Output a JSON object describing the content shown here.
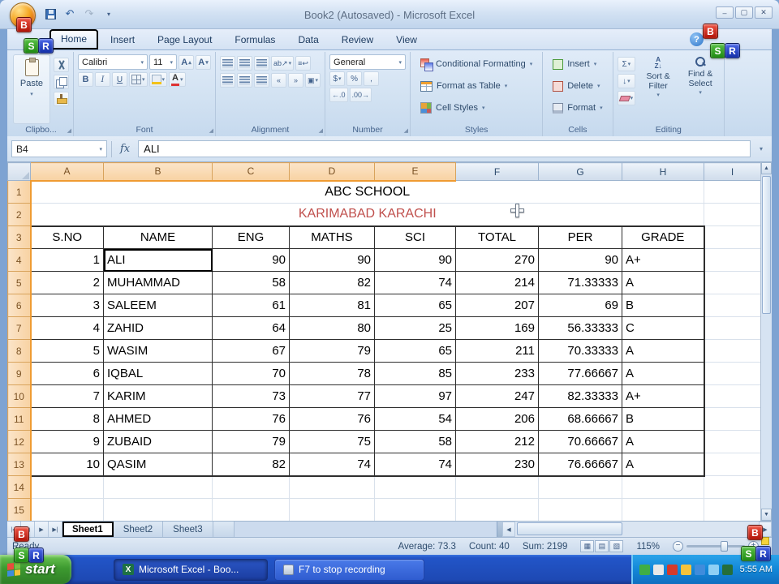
{
  "window": {
    "title": "Book2 (Autosaved) - Microsoft Excel"
  },
  "titlebar_controls": {
    "minimize": "–",
    "maximize": "▢",
    "close": "✕"
  },
  "ribbon": {
    "tabs": [
      {
        "label": "Home",
        "active": true
      },
      {
        "label": "Insert"
      },
      {
        "label": "Page Layout"
      },
      {
        "label": "Formulas"
      },
      {
        "label": "Data"
      },
      {
        "label": "Review"
      },
      {
        "label": "View"
      }
    ],
    "help": "?",
    "clipboard": {
      "label": "Clipbo...",
      "paste": "Paste"
    },
    "font": {
      "label": "Font",
      "family": "Calibri",
      "size": "11",
      "bold": "B",
      "italic": "I",
      "underline": "U"
    },
    "alignment": {
      "label": "Alignment"
    },
    "number": {
      "label": "Number",
      "format": "General",
      "currency": "$",
      "percent": "%",
      "comma": ","
    },
    "styles": {
      "label": "Styles",
      "items": [
        "Conditional Formatting",
        "Format as Table",
        "Cell Styles"
      ]
    },
    "cells": {
      "label": "Cells",
      "items": [
        "Insert",
        "Delete",
        "Format"
      ]
    },
    "editing": {
      "label": "Editing",
      "autosum": "Σ",
      "sort_filter": "Sort & Filter",
      "find_select": "Find & Select"
    }
  },
  "formula_bar": {
    "name_box": "B4",
    "fx": "fx",
    "content": "ALI"
  },
  "sheet": {
    "columns": [
      "A",
      "B",
      "C",
      "D",
      "E",
      "F",
      "G",
      "H",
      "I"
    ],
    "selected_columns": [
      "A",
      "B",
      "C",
      "D",
      "E"
    ],
    "active_cell": "B4",
    "title_row_1": "ABC SCHOOL",
    "title_row_2": "KARIMABAD KARACHI",
    "title_row_2_color": "#C0504D",
    "header_row": [
      "S.NO",
      "NAME",
      "ENG",
      "MATHS",
      "SCI",
      "TOTAL",
      "PER",
      "GRADE"
    ],
    "data_rows": [
      {
        "sno": "1",
        "name": "ALI",
        "eng": "90",
        "maths": "90",
        "sci": "90",
        "total": "270",
        "per": "90",
        "grade": "A+"
      },
      {
        "sno": "2",
        "name": "MUHAMMAD",
        "eng": "58",
        "maths": "82",
        "sci": "74",
        "total": "214",
        "per": "71.33333",
        "grade": "A"
      },
      {
        "sno": "3",
        "name": "SALEEM",
        "eng": "61",
        "maths": "81",
        "sci": "65",
        "total": "207",
        "per": "69",
        "grade": "B"
      },
      {
        "sno": "4",
        "name": "ZAHID",
        "eng": "64",
        "maths": "80",
        "sci": "25",
        "total": "169",
        "per": "56.33333",
        "grade": "C"
      },
      {
        "sno": "5",
        "name": "WASIM",
        "eng": "67",
        "maths": "79",
        "sci": "65",
        "total": "211",
        "per": "70.33333",
        "grade": "A"
      },
      {
        "sno": "6",
        "name": "IQBAL",
        "eng": "70",
        "maths": "78",
        "sci": "85",
        "total": "233",
        "per": "77.66667",
        "grade": "A"
      },
      {
        "sno": "7",
        "name": "KARIM",
        "eng": "73",
        "maths": "77",
        "sci": "97",
        "total": "247",
        "per": "82.33333",
        "grade": "A+"
      },
      {
        "sno": "8",
        "name": "AHMED",
        "eng": "76",
        "maths": "76",
        "sci": "54",
        "total": "206",
        "per": "68.66667",
        "grade": "B"
      },
      {
        "sno": "9",
        "name": "ZUBAID",
        "eng": "79",
        "maths": "75",
        "sci": "58",
        "total": "212",
        "per": "70.66667",
        "grade": "A"
      },
      {
        "sno": "10",
        "name": "QASIM",
        "eng": "82",
        "maths": "74",
        "sci": "74",
        "total": "230",
        "per": "76.66667",
        "grade": "A"
      }
    ]
  },
  "sheet_tabs": {
    "tabs": [
      {
        "label": "Sheet1",
        "active": true
      },
      {
        "label": "Sheet2"
      },
      {
        "label": "Sheet3"
      }
    ]
  },
  "status_bar": {
    "mode": "Ready",
    "average": "Average: 73.3",
    "count": "Count: 40",
    "sum": "Sum: 2199",
    "zoom": "115%"
  },
  "taskbar": {
    "start": "start",
    "buttons": [
      "Microsoft Excel - Boo...",
      "F7 to stop recording"
    ],
    "clock": "5:55 AM"
  },
  "watermark": {
    "b": "B",
    "s": "S",
    "r": "R"
  }
}
